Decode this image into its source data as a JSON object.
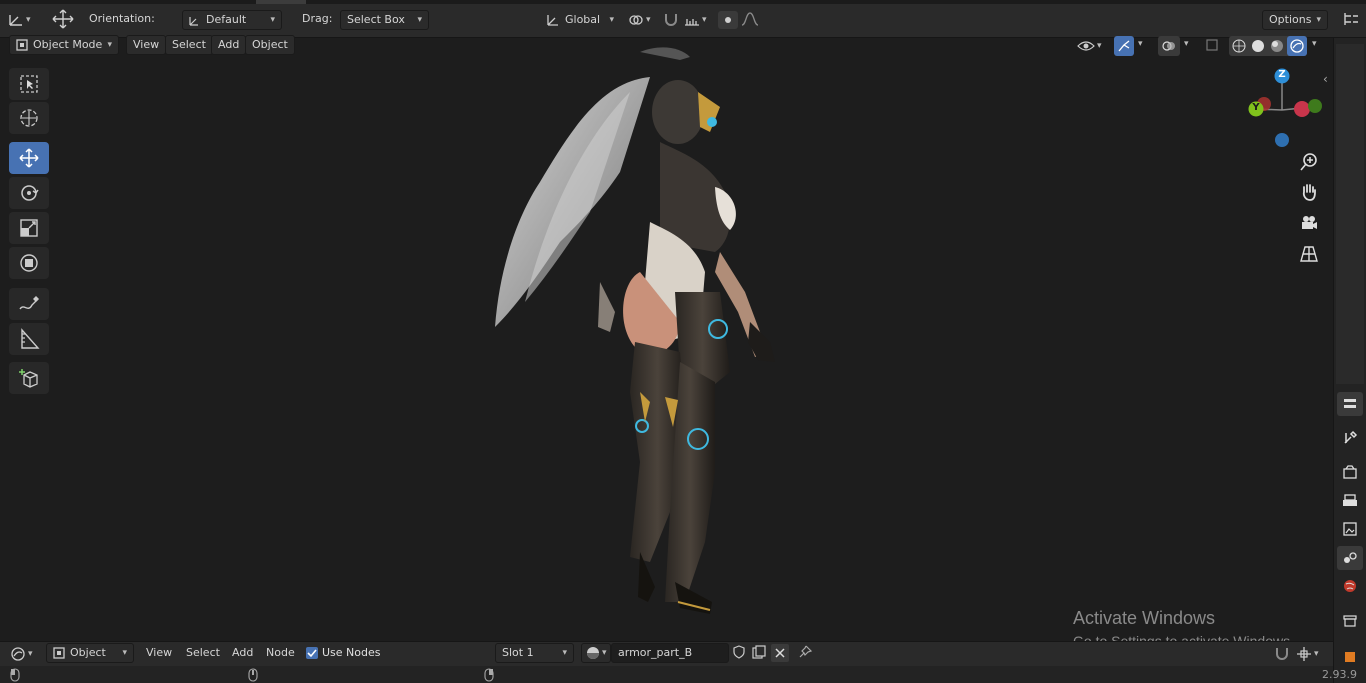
{
  "header": {
    "orientation_label": "Orientation:",
    "orientation_value": "Default",
    "drag_label": "Drag:",
    "drag_value": "Select Box",
    "transform_space": "Global",
    "options_label": "Options"
  },
  "viewport_header": {
    "mode": "Object Mode",
    "menus": [
      "View",
      "Select",
      "Add",
      "Object"
    ]
  },
  "left_toolbar": {
    "tools": [
      "select-box",
      "cursor",
      "move",
      "rotate",
      "scale",
      "transform",
      "annotate",
      "measure",
      "add-cube"
    ],
    "active": "move"
  },
  "navigation_gizmo": {
    "axes": [
      "Z",
      "Y"
    ]
  },
  "node_editor_header": {
    "mode": "Object",
    "menus": [
      "View",
      "Select",
      "Add",
      "Node"
    ],
    "use_nodes_label": "Use Nodes",
    "use_nodes_checked": true,
    "slot": "Slot 1",
    "material_name": "armor_part_B"
  },
  "watermark": {
    "title": "Activate Windows",
    "subtitle": "Go to Settings to activate Windows."
  },
  "status_bar": {
    "version": "2.93.9"
  },
  "colors": {
    "accent": "#4772b3",
    "gizmo_x": "#d4394a",
    "gizmo_y": "#80c21c",
    "gizmo_z": "#2e8fd8"
  }
}
